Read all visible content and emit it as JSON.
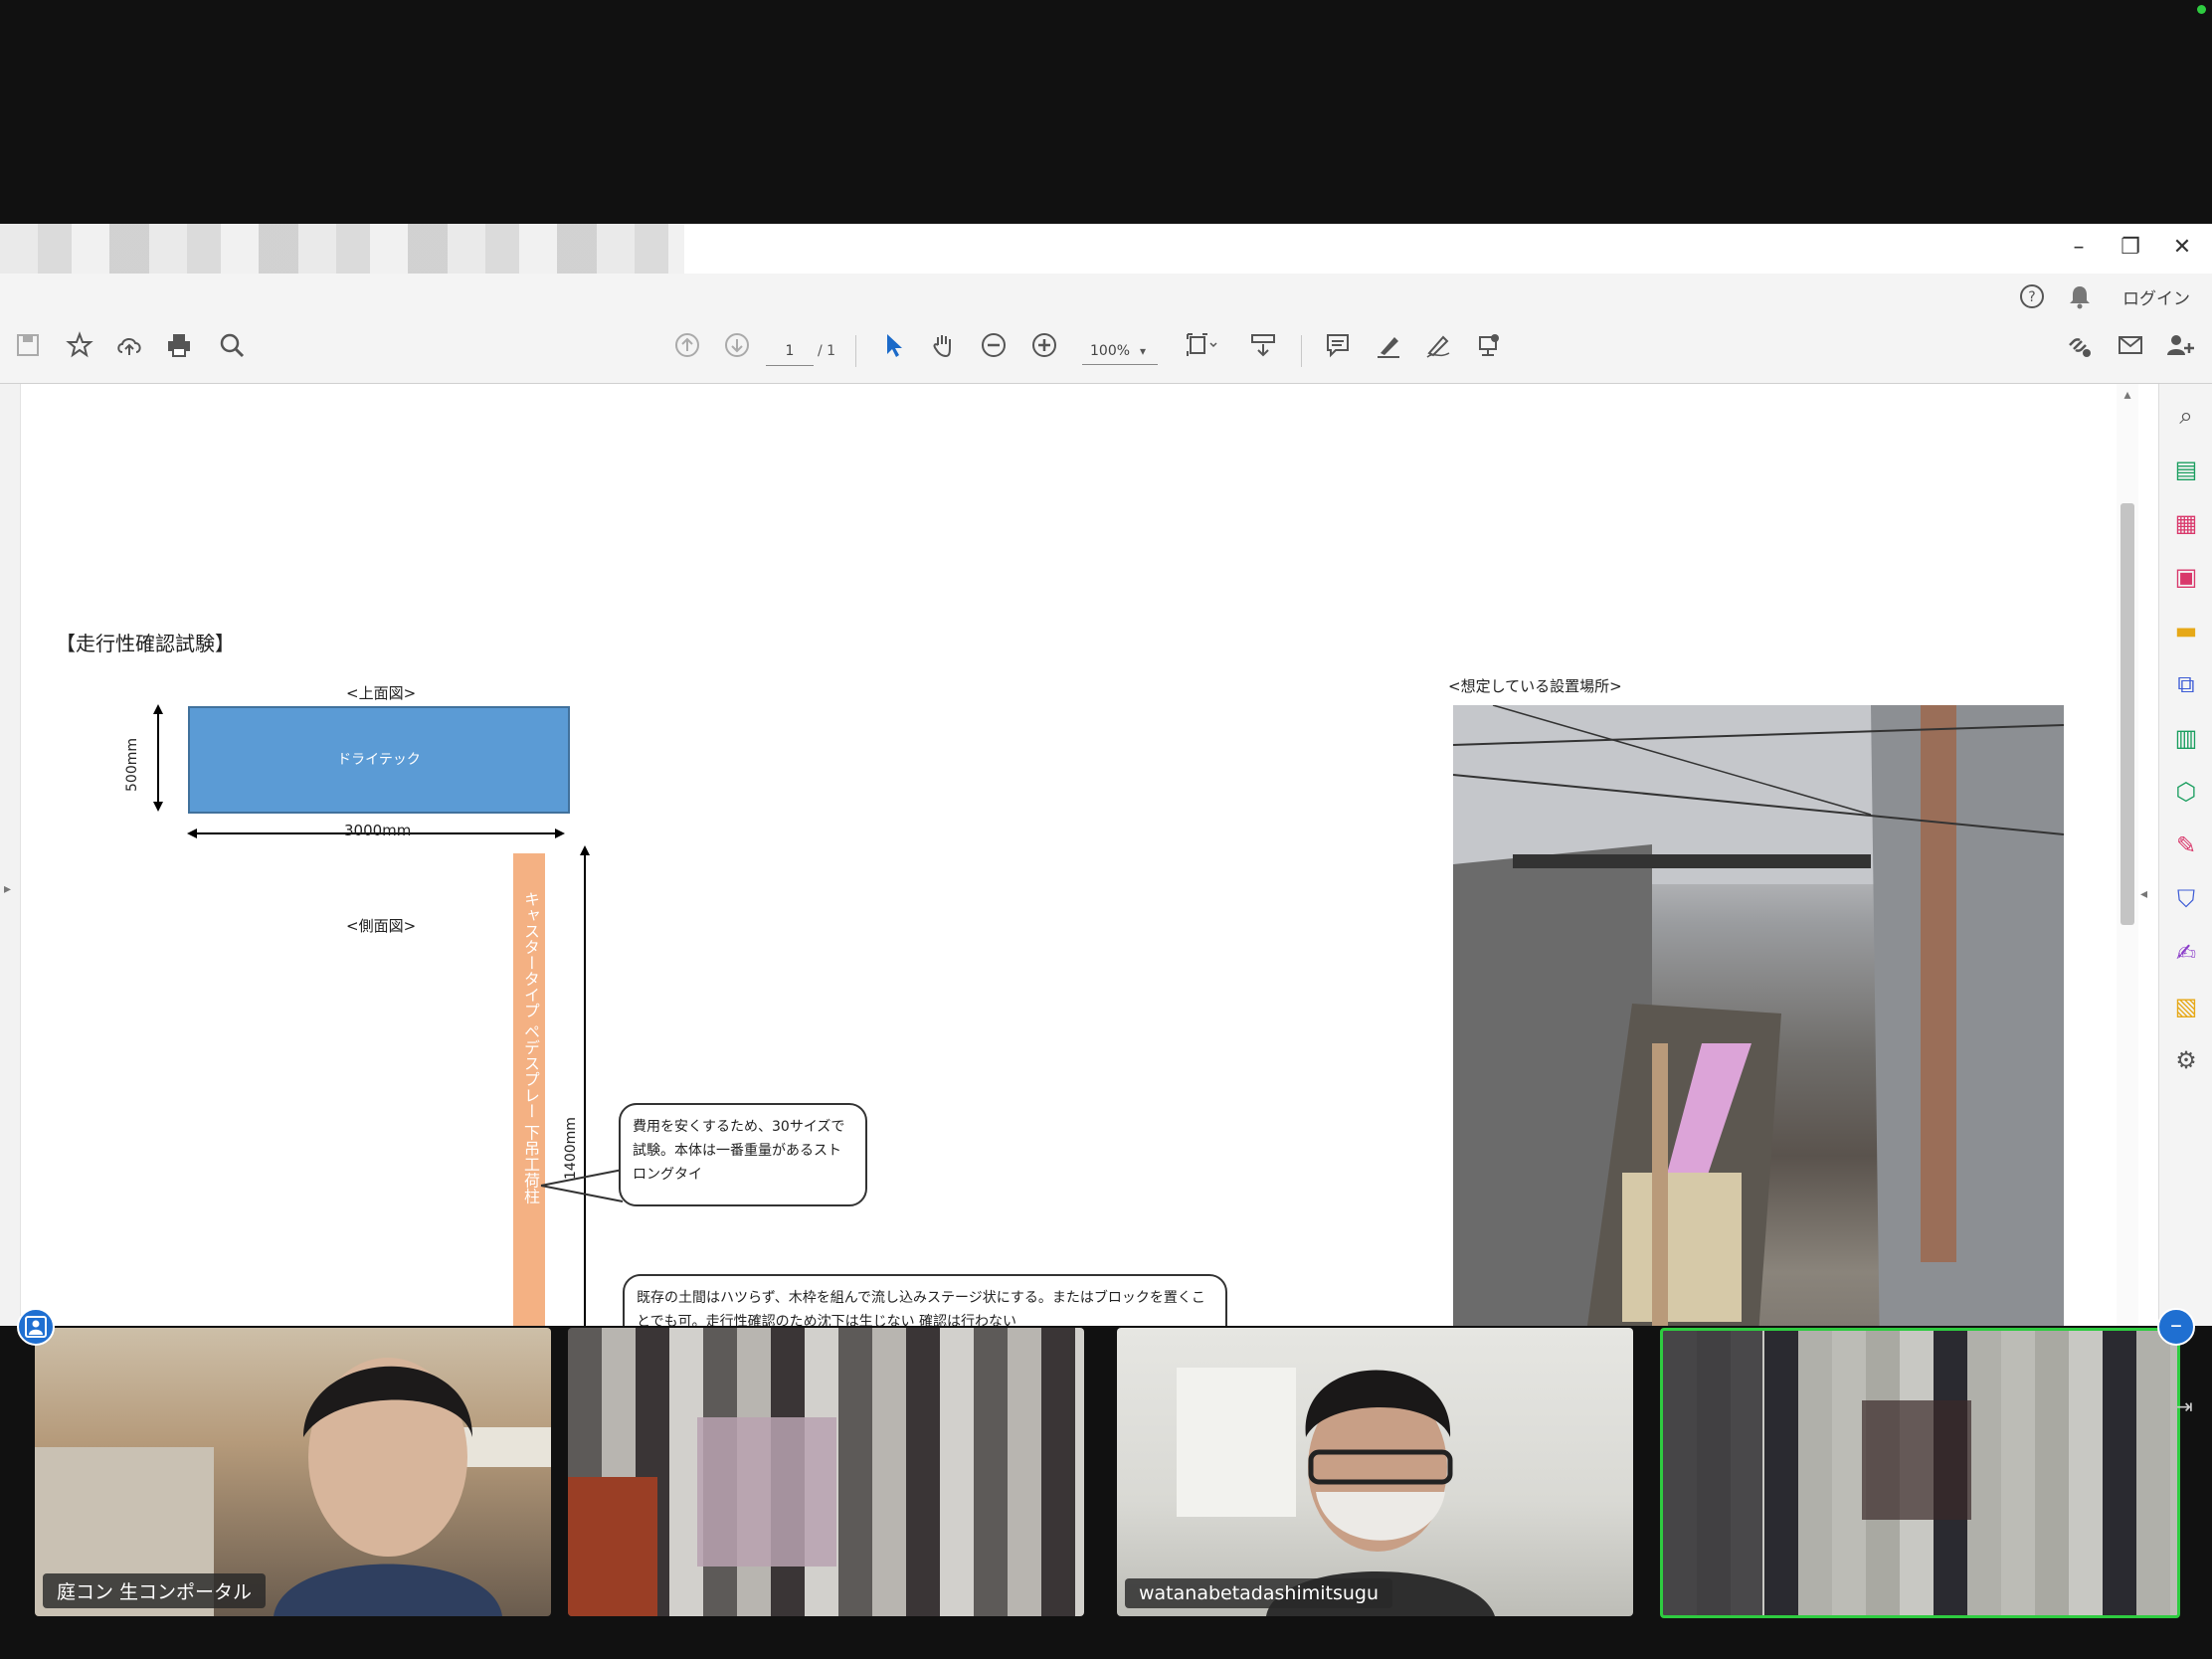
{
  "window": {
    "close_glyph": "✕",
    "restore_glyph": "❐",
    "minimize_glyph": "–"
  },
  "menubar": {
    "help_icon": "help-icon",
    "bell_icon": "bell-icon",
    "login_label": "ログイン"
  },
  "toolbar": {
    "page_current": "1",
    "page_total": "/ 1",
    "zoom_value": "100%",
    "icons": [
      "save-icon",
      "star-icon",
      "cloud-upload-icon",
      "print-icon",
      "search-icon",
      "prev-page-icon",
      "next-page-icon",
      "cursor-icon",
      "hand-icon",
      "zoom-out-icon",
      "zoom-in-icon",
      "page-fit-icon",
      "scroll-mode-icon",
      "comment-icon",
      "highlight-icon",
      "sign-icon",
      "stamp-icon",
      "share-link-icon",
      "email-icon",
      "add-user-icon"
    ]
  },
  "document": {
    "heading": "【走行性確認試験】",
    "top_view_label": "<上面図>",
    "product_name": "ドライテック",
    "dim_width": "500mm",
    "dim_length": "3000mm",
    "side_view_label": "<側面図>",
    "orange_bar_text": "キャスタータイプ ペデスプレー 下吊工荷柱",
    "dim_height": "1400mm",
    "callout_1": "費用を安くするため、30サイズで試験。本体は一番重量があるストロングタイ",
    "callout_2": "既存の土間はハツらず、木枠を組んで流し込みステージ状にする。またはブロックを置くことでも可。走行性確認のため沈下は生じない 確認は行わない",
    "photo_label": "<想定している設置場所>"
  },
  "participants": [
    {
      "name": "庭コン 生コンポータル"
    },
    {
      "name": ""
    },
    {
      "name": "watanabetadashimitsugu"
    },
    {
      "name": ""
    }
  ],
  "colors": {
    "active_speaker": "#2ecc40",
    "box_blue": "#5b9bd5",
    "bar_orange": "#f4b183",
    "zoom_blue": "#1f6fd1"
  }
}
